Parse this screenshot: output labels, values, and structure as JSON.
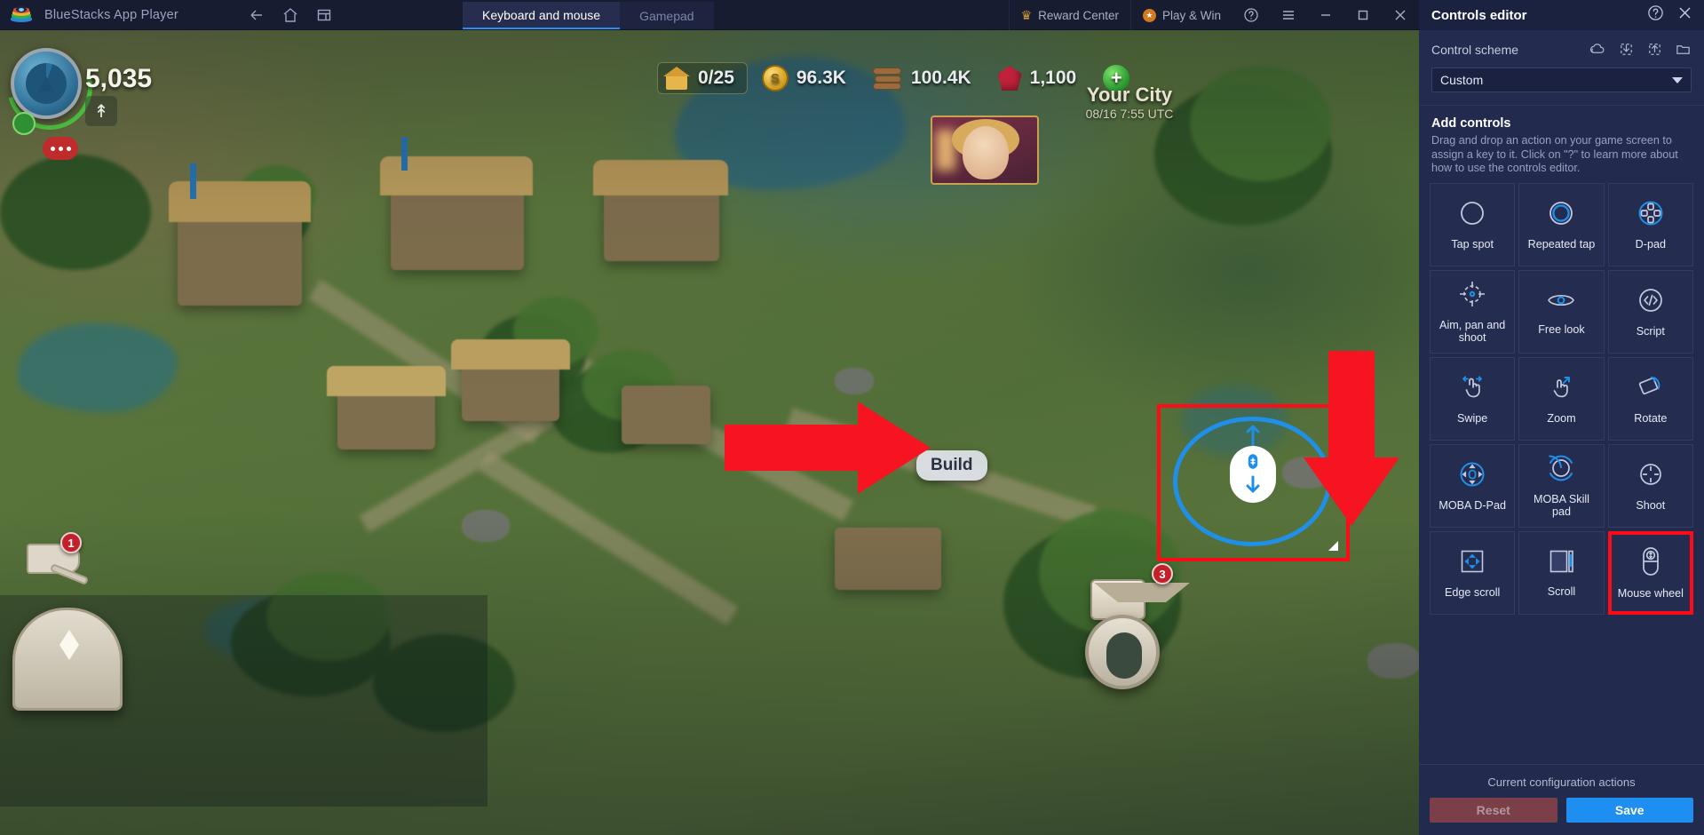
{
  "window": {
    "app_title": "BlueStacks App Player",
    "nav": [
      {
        "name": "back-icon",
        "label": "Back"
      },
      {
        "name": "home-icon",
        "label": "Home"
      },
      {
        "name": "multi-instance-icon",
        "label": "Multi-instance"
      }
    ],
    "tabs": [
      {
        "label": "Keyboard and mouse",
        "active": true
      },
      {
        "label": "Gamepad",
        "active": false
      }
    ],
    "actions": [
      {
        "label": "Reward Center",
        "icon": "crown-icon"
      },
      {
        "label": "Play & Win",
        "icon": "star-badge-icon"
      }
    ],
    "controls": [
      {
        "name": "help-icon",
        "label": "Help"
      },
      {
        "name": "menu-icon",
        "label": "Menu"
      },
      {
        "name": "minimize-icon",
        "label": "Minimize"
      },
      {
        "name": "maximize-icon",
        "label": "Maximize"
      },
      {
        "name": "close-icon",
        "label": "Close"
      }
    ]
  },
  "game_hud": {
    "power": "5,035",
    "resources": [
      {
        "icon": "house-icon",
        "value": "0/25"
      },
      {
        "icon": "coin-icon",
        "value": "96.3K"
      },
      {
        "icon": "wood-icon",
        "value": "100.4K"
      },
      {
        "icon": "gem-icon",
        "value": "1,100"
      },
      {
        "icon": "plus-icon",
        "value": "+"
      }
    ],
    "city_name": "Your City",
    "city_time": "08/16 7:55 UTC",
    "build_button": "Build",
    "badges": [
      "1",
      "3"
    ]
  },
  "overlay_control": {
    "name": "mouse-wheel-control",
    "highlight_color": "#ff0a17",
    "ring_color": "#1f8fe8"
  },
  "annotations": {
    "arrow_color": "#ff0a17",
    "arrow_right_name": "red-arrow-right",
    "arrow_down_name": "red-arrow-down"
  },
  "panel": {
    "title": "Controls editor",
    "help_icon": "question-circle-icon",
    "close_icon": "close-icon",
    "scheme": {
      "label": "Control scheme",
      "icons": [
        {
          "name": "restore-cloud-icon"
        },
        {
          "name": "import-icon"
        },
        {
          "name": "export-icon"
        },
        {
          "name": "folder-icon"
        }
      ],
      "selected": "Custom"
    },
    "add": {
      "title": "Add controls",
      "description": "Drag and drop an action on your game screen to assign a key to it. Click on \"?\" to learn more about how to use the controls editor."
    },
    "items": [
      {
        "label": "Tap spot",
        "icon": "tap-spot-icon",
        "marked": false
      },
      {
        "label": "Repeated tap",
        "icon": "repeated-tap-icon",
        "marked": false
      },
      {
        "label": "D-pad",
        "icon": "dpad-icon",
        "marked": false
      },
      {
        "label": "Aim, pan and shoot",
        "icon": "aim-pan-shoot-icon",
        "marked": false
      },
      {
        "label": "Free look",
        "icon": "free-look-icon",
        "marked": false
      },
      {
        "label": "Script",
        "icon": "script-icon",
        "marked": false
      },
      {
        "label": "Swipe",
        "icon": "swipe-icon",
        "marked": false
      },
      {
        "label": "Zoom",
        "icon": "zoom-icon",
        "marked": false
      },
      {
        "label": "Rotate",
        "icon": "rotate-icon",
        "marked": false
      },
      {
        "label": "MOBA D-Pad",
        "icon": "moba-dpad-icon",
        "marked": false
      },
      {
        "label": "MOBA Skill pad",
        "icon": "moba-skill-pad-icon",
        "marked": false
      },
      {
        "label": "Shoot",
        "icon": "shoot-icon",
        "marked": false
      },
      {
        "label": "Edge scroll",
        "icon": "edge-scroll-icon",
        "marked": false
      },
      {
        "label": "Scroll",
        "icon": "scroll-icon",
        "marked": false
      },
      {
        "label": "Mouse wheel",
        "icon": "mouse-wheel-icon",
        "marked": true
      }
    ],
    "footer": {
      "title": "Current configuration actions",
      "reset": "Reset",
      "save": "Save"
    }
  }
}
